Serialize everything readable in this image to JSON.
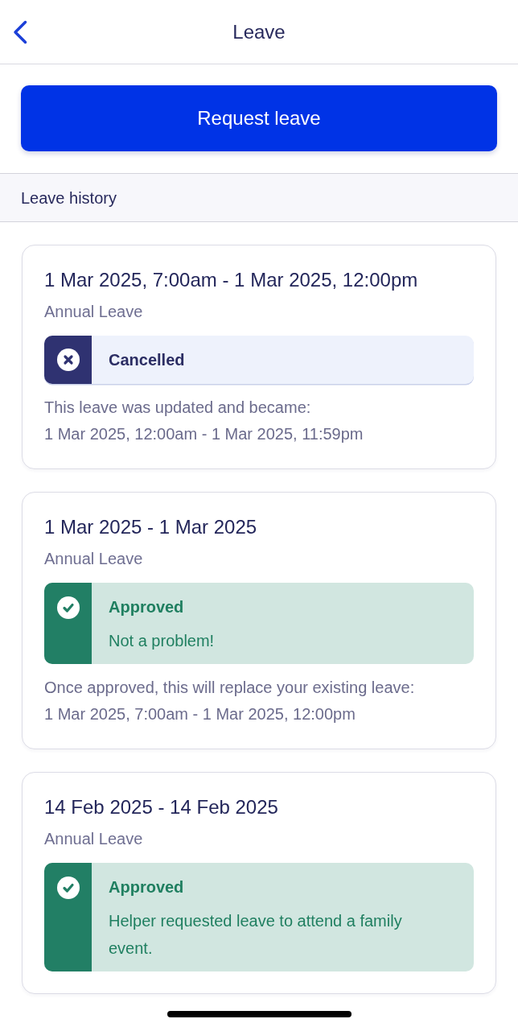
{
  "header": {
    "title": "Leave"
  },
  "request_button": {
    "label": "Request leave"
  },
  "section": {
    "title": "Leave history"
  },
  "leaves": [
    {
      "dates": "1 Mar 2025, 7:00am - 1 Mar 2025, 12:00pm",
      "type": "Annual Leave",
      "status": {
        "kind": "cancelled",
        "label": "Cancelled"
      },
      "note_lines": [
        "This leave was updated and became:",
        "1 Mar 2025, 12:00am - 1 Mar 2025, 11:59pm"
      ]
    },
    {
      "dates": "1 Mar 2025 - 1 Mar 2025",
      "type": "Annual Leave",
      "status": {
        "kind": "approved",
        "label": "Approved",
        "message": "Not a problem!"
      },
      "note_lines": [
        "Once approved, this will replace your existing leave:",
        "1 Mar 2025, 7:00am - 1 Mar 2025, 12:00pm"
      ]
    },
    {
      "dates": "14 Feb 2025 - 14 Feb 2025",
      "type": "Annual Leave",
      "status": {
        "kind": "approved",
        "label": "Approved",
        "message": "Helper requested leave to attend a family event."
      }
    }
  ]
}
